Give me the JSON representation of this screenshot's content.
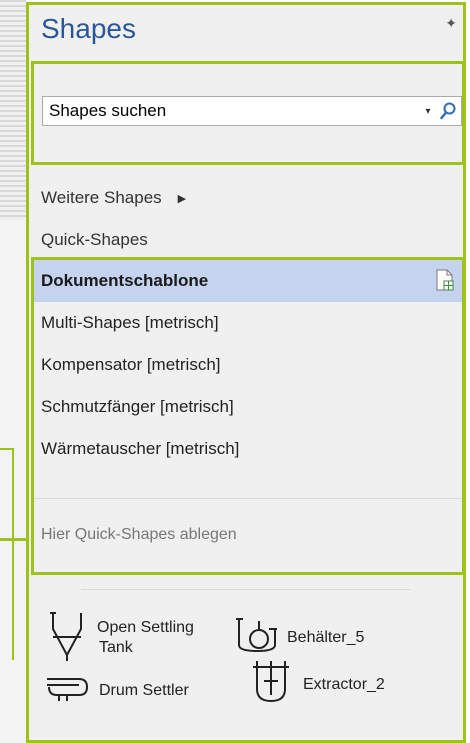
{
  "panel": {
    "title": "Shapes",
    "pin_glyph": "✦"
  },
  "search": {
    "value": "Shapes suchen",
    "dropdown_glyph": "▾"
  },
  "menu": {
    "more_shapes": "Weitere Shapes",
    "more_arrow": "▶",
    "quick_shapes": "Quick-Shapes"
  },
  "stencils": {
    "items": [
      {
        "label": "Dokumentschablone",
        "active": true
      },
      {
        "label": "Multi-Shapes [metrisch]",
        "active": false
      },
      {
        "label": "Kompensator [metrisch]",
        "active": false
      },
      {
        "label": "Schmutzfänger [metrisch]",
        "active": false
      },
      {
        "label": "Wärmetauscher [metrisch]",
        "active": false
      }
    ],
    "drop_hint": "Hier Quick-Shapes ablegen"
  },
  "shapes": [
    {
      "label_line1": "Open Settling",
      "label_line2": "Tank",
      "icon": "open-settling-tank-icon"
    },
    {
      "label_line1": "Behälter_5",
      "label_line2": "",
      "icon": "behaelter-5-icon"
    },
    {
      "label_line1": "Drum Settler",
      "label_line2": "",
      "icon": "drum-settler-icon"
    },
    {
      "label_line1": "Extractor_2",
      "label_line2": "",
      "icon": "extractor-2-icon"
    }
  ],
  "colors": {
    "highlight_border": "#9dc31a",
    "title_blue": "#2b579a",
    "active_row": "#c5d3ef",
    "search_icon": "#2e6db4"
  }
}
